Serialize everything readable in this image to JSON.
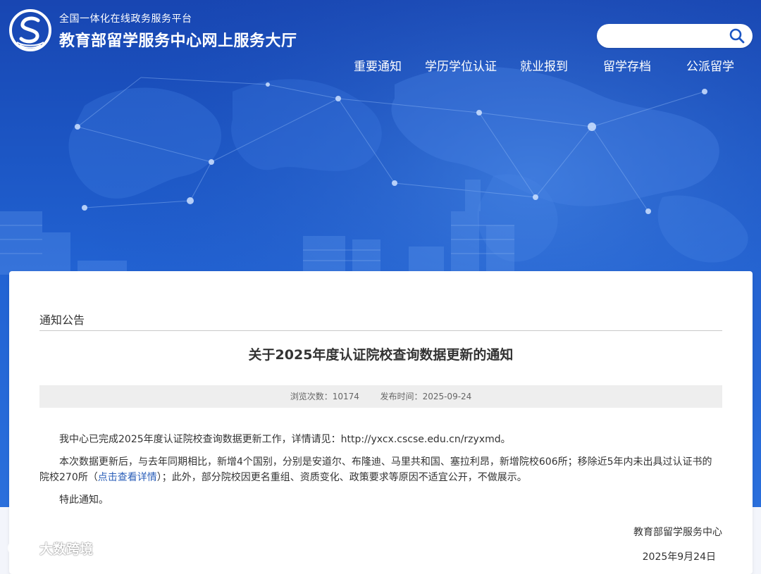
{
  "header": {
    "platform_subtitle": "全国一体化在线政务服务平台",
    "site_title": "教育部留学服务中心网上服务大厅",
    "search": {
      "placeholder": "",
      "value": "",
      "icon": "search-icon"
    },
    "logo_icon": "cscse-logo"
  },
  "nav": {
    "items": [
      {
        "label": "重要通知"
      },
      {
        "label": "学历学位认证"
      },
      {
        "label": "就业报到"
      },
      {
        "label": "留学存档"
      },
      {
        "label": "公派留学"
      }
    ]
  },
  "article": {
    "section_heading": "通知公告",
    "title": "关于2025年度认证院校查询数据更新的通知",
    "meta": {
      "views_label": "浏览次数：",
      "views": "10174",
      "published_label": "发布时间：",
      "published": "2025-09-24"
    },
    "paragraph1": "我中心已完成2025年度认证院校查询数据更新工作，详情请见：http://yxcx.cscse.edu.cn/rzyxmd。",
    "paragraph2_before": "本次数据更新后，与去年同期相比，新增4个国别，分别是安道尔、布隆迪、马里共和国、塞拉利昂，新增院校606所；移除近5年内未出具过认证书的院校270所（",
    "paragraph2_link": "点击查看详情",
    "paragraph2_after": "）；此外，部分院校因更名重组、资质变化、政策要求等原因不适宜公开，不做展示。",
    "paragraph3": "特此通知。",
    "signature_org": "教育部留学服务中心",
    "signature_date": "2025年9月24日"
  },
  "watermark": {
    "text": "大数跨境"
  },
  "colors": {
    "brand_blue": "#1c56c4",
    "link": "#2a5eb8",
    "text": "#333333"
  }
}
